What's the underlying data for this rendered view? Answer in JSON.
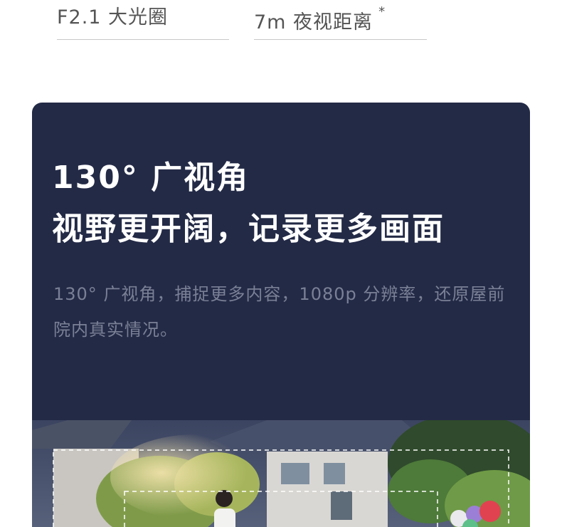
{
  "specs": {
    "aperture": "F2.1 大光圈",
    "night_vision": "7m 夜视距离",
    "night_vision_mark": "*"
  },
  "card": {
    "headline_line1": "130° 广视角",
    "headline_line2": "视野更开阔，记录更多画面",
    "description": "130° 广视角，捕捉更多内容，1080p 分辨率，还原屋前院内真实情况。"
  },
  "colors": {
    "card_bg": "#232a46",
    "headline": "#ffffff",
    "description": "#7a8095"
  }
}
